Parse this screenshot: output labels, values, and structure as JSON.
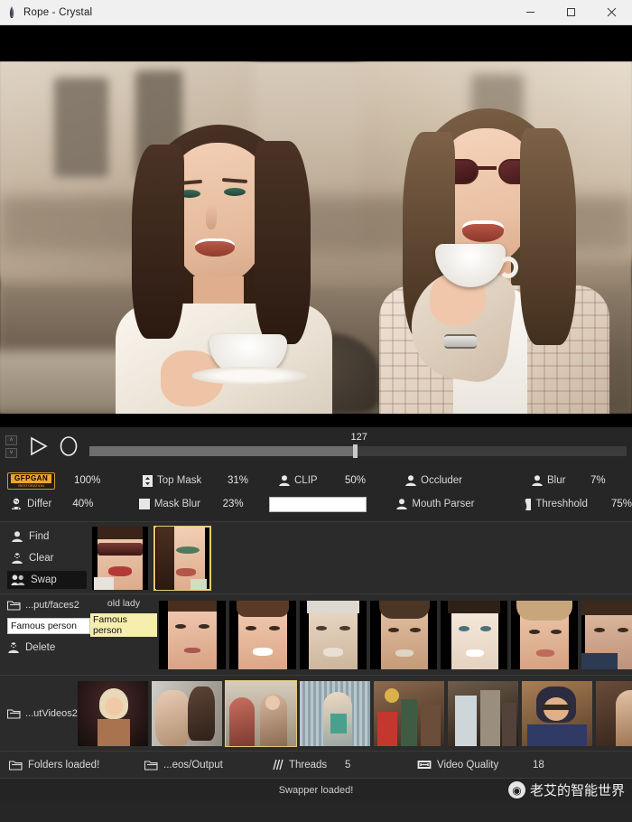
{
  "window": {
    "title": "Rope - Crystal",
    "app_icon": "feather-icon",
    "minimize": "—",
    "maximize": "□",
    "close": "✕"
  },
  "transport": {
    "step_back_label": "˄",
    "step_fwd_label": "˅",
    "play_icon": "play-icon",
    "record_icon": "record-icon",
    "frame_value": "127",
    "slider_percent": 49
  },
  "params": {
    "row1": [
      {
        "name": "gfpgan",
        "icon": "gfpgan-badge",
        "label": "GFPGAN",
        "sub": "RESTORATION",
        "value": "100%"
      },
      {
        "name": "top-mask",
        "icon": "top-mask-icon",
        "label": "Top Mask",
        "value": "31%"
      },
      {
        "name": "clip",
        "icon": "person-icon",
        "label": "CLIP",
        "value": "50%"
      },
      {
        "name": "occluder",
        "icon": "person-icon",
        "label": "Occluder",
        "value": ""
      },
      {
        "name": "blur",
        "icon": "person-icon",
        "label": "Blur",
        "value": "7%"
      }
    ],
    "row2": [
      {
        "name": "differ",
        "icon": "differ-icon",
        "label": "Differ",
        "value": "40%"
      },
      {
        "name": "mask-blur",
        "icon": "checkbox-icon",
        "label": "Mask Blur",
        "value": "23%"
      },
      {
        "name": "clip-text",
        "icon": "text-input",
        "label": "",
        "value": ""
      },
      {
        "name": "mouth-parser",
        "icon": "person-icon",
        "label": "Mouth Parser",
        "value": ""
      },
      {
        "name": "threshhold",
        "icon": "threshold-icon",
        "label": "Threshhold",
        "value": "75%"
      }
    ]
  },
  "facefind": {
    "buttons": [
      {
        "name": "find",
        "label": "Find",
        "icon": "person-icon",
        "active": false
      },
      {
        "name": "clear",
        "label": "Clear",
        "icon": "person-clear-icon",
        "active": false
      },
      {
        "name": "swap",
        "label": "Swap",
        "icon": "two-people-icon",
        "active": true
      }
    ],
    "thumbs": [
      {
        "name": "found-face-1",
        "selected": false
      },
      {
        "name": "found-face-2",
        "selected": true
      }
    ]
  },
  "faceslib": {
    "folder_icon": "folder-icon",
    "folder_label": "...put/faces2",
    "input_value": "Famous person",
    "delete_label": "Delete",
    "delete_icon": "delete-icon",
    "tags": [
      {
        "label": "old lady",
        "highlight": false
      },
      {
        "label": "Famous person",
        "highlight": true
      }
    ],
    "thumb_count": 7
  },
  "videoslib": {
    "folder_icon": "folder-icon",
    "folder_label": "...utVideos2",
    "selected_index": 2,
    "thumb_count": 8
  },
  "status": {
    "items": [
      {
        "name": "folders-loaded",
        "icon": "folder-icon",
        "label": "Folders loaded!",
        "value": ""
      },
      {
        "name": "output-folder",
        "icon": "folder-icon",
        "label": "...eos/Output",
        "value": ""
      },
      {
        "name": "threads",
        "icon": "threads-icon",
        "label": "Threads",
        "value": "5"
      },
      {
        "name": "video-quality",
        "icon": "film-icon",
        "label": "Video Quality",
        "value": "18"
      }
    ],
    "message": "Swapper loaded!",
    "watermark": "老艾的智能世界",
    "watermark_icon": "weibo-icon"
  },
  "colors": {
    "accent_gold": "#e6c870",
    "panel_bg": "#2b2b2b",
    "window_bg": "#262626",
    "gfpgan_orange": "#f0a52a",
    "tag_highlight": "#f5eeae"
  }
}
